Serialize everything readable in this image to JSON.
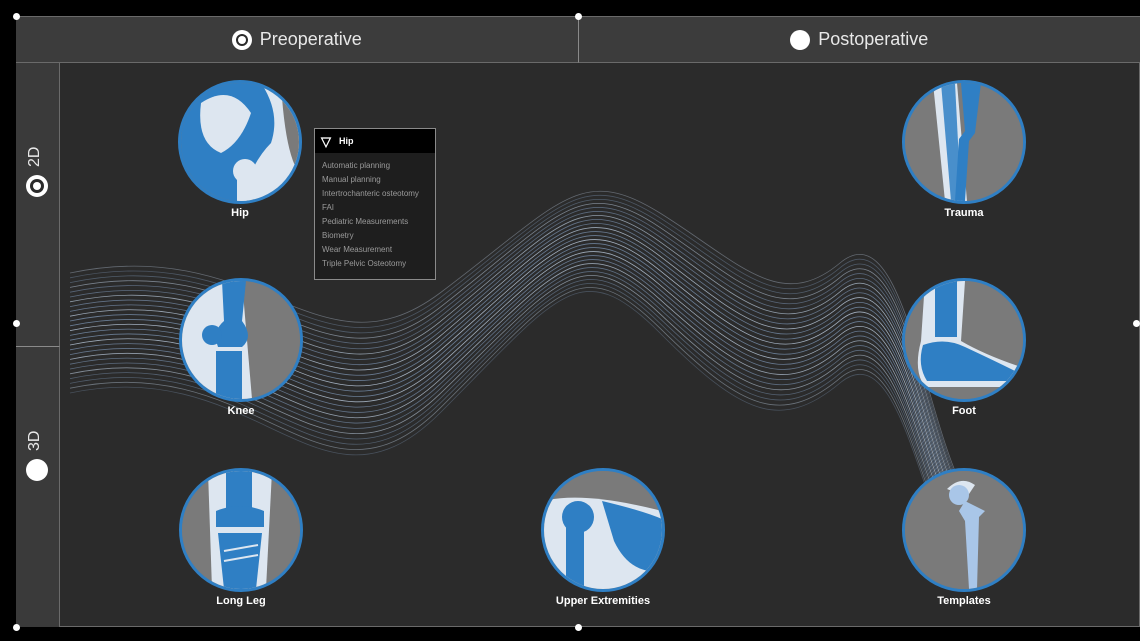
{
  "top_tabs": [
    {
      "label": "Preoperative",
      "selected": true
    },
    {
      "label": "Postoperative",
      "selected": false
    }
  ],
  "side_tabs": [
    {
      "label": "2D",
      "selected": true
    },
    {
      "label": "3D",
      "selected": false
    }
  ],
  "cards": {
    "hip": {
      "label": "Hip"
    },
    "knee": {
      "label": "Knee"
    },
    "long_leg": {
      "label": "Long Leg"
    },
    "upper_extremities": {
      "label": "Upper Extremities"
    },
    "trauma": {
      "label": "Trauma"
    },
    "foot": {
      "label": "Foot"
    },
    "templates": {
      "label": "Templates"
    }
  },
  "hip_menu": {
    "title": "Hip",
    "items": [
      "Automatic planning",
      "Manual planning",
      "Intertrochanteric osteotomy",
      "FAI",
      "Pediatric Measurements",
      "Biometry",
      "Wear Measurement",
      "Triple Pelvic Osteotomy"
    ]
  },
  "colors": {
    "accent_blue": "#2f7fc4",
    "bone_light": "#dde6f0",
    "background": "#2b2b2b"
  }
}
